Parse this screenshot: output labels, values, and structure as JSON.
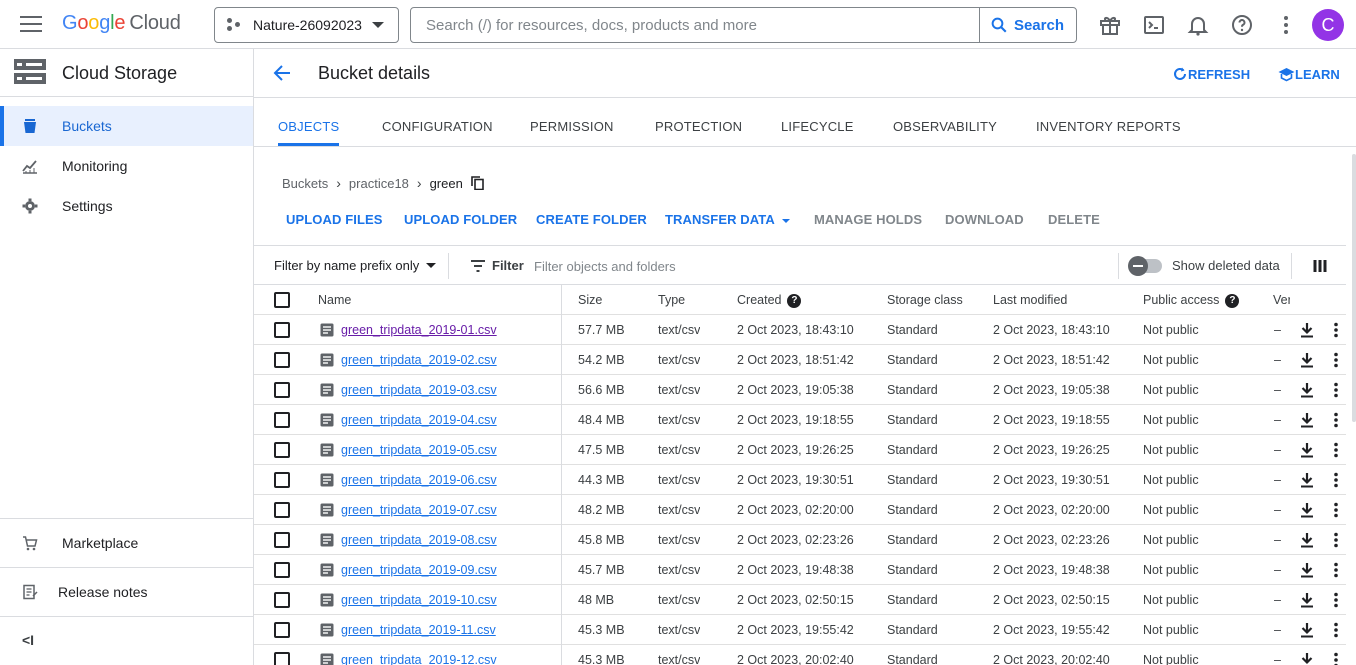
{
  "topbar": {
    "logo": {
      "g": "G",
      "o1": "o",
      "o2": "o",
      "g2": "g",
      "l": "l",
      "e": "e",
      "cloud": "Cloud"
    },
    "project_name": "Nature-26092023",
    "search_placeholder": "Search (/) for resources, docs, products and more",
    "search_button": "Search",
    "avatar_letter": "C",
    "avatar_color": "#9334e6"
  },
  "sidebar": {
    "product_title": "Cloud Storage",
    "items": [
      {
        "label": "Buckets",
        "icon": "bucket-icon"
      },
      {
        "label": "Monitoring",
        "icon": "chart-icon"
      },
      {
        "label": "Settings",
        "icon": "gear-icon"
      }
    ],
    "bottom": [
      {
        "label": "Marketplace",
        "icon": "cart-icon"
      },
      {
        "label": "Release notes",
        "icon": "notes-icon"
      }
    ],
    "collapse_label": "<I"
  },
  "header": {
    "title": "Bucket details",
    "refresh": "REFRESH",
    "learn": "LEARN"
  },
  "tabs": [
    "OBJECTS",
    "CONFIGURATION",
    "PERMISSION",
    "PROTECTION",
    "LIFECYCLE",
    "OBSERVABILITY",
    "INVENTORY REPORTS"
  ],
  "breadcrumb": {
    "root": "Buckets",
    "bucket": "practice18",
    "folder": "green"
  },
  "actions": {
    "upload_files": "UPLOAD FILES",
    "upload_folder": "UPLOAD FOLDER",
    "create_folder": "CREATE FOLDER",
    "transfer_data": "TRANSFER DATA",
    "manage_holds": "MANAGE HOLDS",
    "download": "DOWNLOAD",
    "delete": "DELETE"
  },
  "filterbar": {
    "prefix_select": "Filter by name prefix only",
    "filter_label": "Filter",
    "filter_placeholder": "Filter objects and folders",
    "show_deleted": "Show deleted data"
  },
  "table": {
    "columns": {
      "name": "Name",
      "size": "Size",
      "type": "Type",
      "created": "Created",
      "storage_class": "Storage class",
      "last_modified": "Last modified",
      "public_access": "Public access",
      "version": "Ver"
    },
    "rows": [
      {
        "name": "green_tripdata_2019-01.csv",
        "size": "57.7 MB",
        "type": "text/csv",
        "created": "2 Oct 2023, 18:43:10",
        "storage_class": "Standard",
        "last_modified": "2 Oct 2023, 18:43:10",
        "public_access": "Not public",
        "version": "–"
      },
      {
        "name": "green_tripdata_2019-02.csv",
        "size": "54.2 MB",
        "type": "text/csv",
        "created": "2 Oct 2023, 18:51:42",
        "storage_class": "Standard",
        "last_modified": "2 Oct 2023, 18:51:42",
        "public_access": "Not public",
        "version": "–"
      },
      {
        "name": "green_tripdata_2019-03.csv",
        "size": "56.6 MB",
        "type": "text/csv",
        "created": "2 Oct 2023, 19:05:38",
        "storage_class": "Standard",
        "last_modified": "2 Oct 2023, 19:05:38",
        "public_access": "Not public",
        "version": "–"
      },
      {
        "name": "green_tripdata_2019-04.csv",
        "size": "48.4 MB",
        "type": "text/csv",
        "created": "2 Oct 2023, 19:18:55",
        "storage_class": "Standard",
        "last_modified": "2 Oct 2023, 19:18:55",
        "public_access": "Not public",
        "version": "–"
      },
      {
        "name": "green_tripdata_2019-05.csv",
        "size": "47.5 MB",
        "type": "text/csv",
        "created": "2 Oct 2023, 19:26:25",
        "storage_class": "Standard",
        "last_modified": "2 Oct 2023, 19:26:25",
        "public_access": "Not public",
        "version": "–"
      },
      {
        "name": "green_tripdata_2019-06.csv",
        "size": "44.3 MB",
        "type": "text/csv",
        "created": "2 Oct 2023, 19:30:51",
        "storage_class": "Standard",
        "last_modified": "2 Oct 2023, 19:30:51",
        "public_access": "Not public",
        "version": "–"
      },
      {
        "name": "green_tripdata_2019-07.csv",
        "size": "48.2 MB",
        "type": "text/csv",
        "created": "2 Oct 2023, 02:20:00",
        "storage_class": "Standard",
        "last_modified": "2 Oct 2023, 02:20:00",
        "public_access": "Not public",
        "version": "–"
      },
      {
        "name": "green_tripdata_2019-08.csv",
        "size": "45.8 MB",
        "type": "text/csv",
        "created": "2 Oct 2023, 02:23:26",
        "storage_class": "Standard",
        "last_modified": "2 Oct 2023, 02:23:26",
        "public_access": "Not public",
        "version": "–"
      },
      {
        "name": "green_tripdata_2019-09.csv",
        "size": "45.7 MB",
        "type": "text/csv",
        "created": "2 Oct 2023, 19:48:38",
        "storage_class": "Standard",
        "last_modified": "2 Oct 2023, 19:48:38",
        "public_access": "Not public",
        "version": "–"
      },
      {
        "name": "green_tripdata_2019-10.csv",
        "size": "48 MB",
        "type": "text/csv",
        "created": "2 Oct 2023, 02:50:15",
        "storage_class": "Standard",
        "last_modified": "2 Oct 2023, 02:50:15",
        "public_access": "Not public",
        "version": "–"
      },
      {
        "name": "green_tripdata_2019-11.csv",
        "size": "45.3 MB",
        "type": "text/csv",
        "created": "2 Oct 2023, 19:55:42",
        "storage_class": "Standard",
        "last_modified": "2 Oct 2023, 19:55:42",
        "public_access": "Not public",
        "version": "–"
      },
      {
        "name": "green_tripdata_2019-12.csv",
        "size": "45.3 MB",
        "type": "text/csv",
        "created": "2 Oct 2023, 20:02:40",
        "storage_class": "Standard",
        "last_modified": "2 Oct 2023, 20:02:40",
        "public_access": "Not public",
        "version": "–"
      }
    ]
  },
  "colors": {
    "accent": "#1a73e8",
    "active_nav_bg": "#e8f0fe",
    "visited_link": "#681da8"
  }
}
